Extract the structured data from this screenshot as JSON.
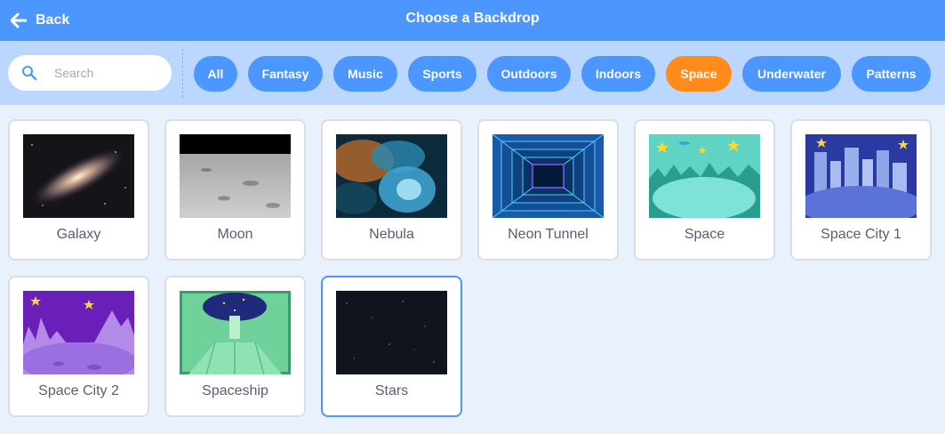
{
  "header": {
    "back_label": "Back",
    "title": "Choose a Backdrop"
  },
  "search": {
    "placeholder": "Search",
    "value": ""
  },
  "tags": [
    {
      "label": "All",
      "active": false
    },
    {
      "label": "Fantasy",
      "active": false
    },
    {
      "label": "Music",
      "active": false
    },
    {
      "label": "Sports",
      "active": false
    },
    {
      "label": "Outdoors",
      "active": false
    },
    {
      "label": "Indoors",
      "active": false
    },
    {
      "label": "Space",
      "active": true
    },
    {
      "label": "Underwater",
      "active": false
    },
    {
      "label": "Patterns",
      "active": false
    }
  ],
  "backdrops": [
    {
      "name": "Galaxy",
      "selected": false
    },
    {
      "name": "Moon",
      "selected": false
    },
    {
      "name": "Nebula",
      "selected": false
    },
    {
      "name": "Neon Tunnel",
      "selected": false
    },
    {
      "name": "Space",
      "selected": false
    },
    {
      "name": "Space City 1",
      "selected": false
    },
    {
      "name": "Space City 2",
      "selected": false
    },
    {
      "name": "Spaceship",
      "selected": false
    },
    {
      "name": "Stars",
      "selected": true
    }
  ],
  "colors": {
    "header": "#4c97ff",
    "filter_bar": "#bcd7fd",
    "active_tag": "#ff8c1a",
    "background": "#e9f1fc"
  },
  "icons": {
    "back": "back-arrow-icon",
    "search": "search-icon"
  }
}
